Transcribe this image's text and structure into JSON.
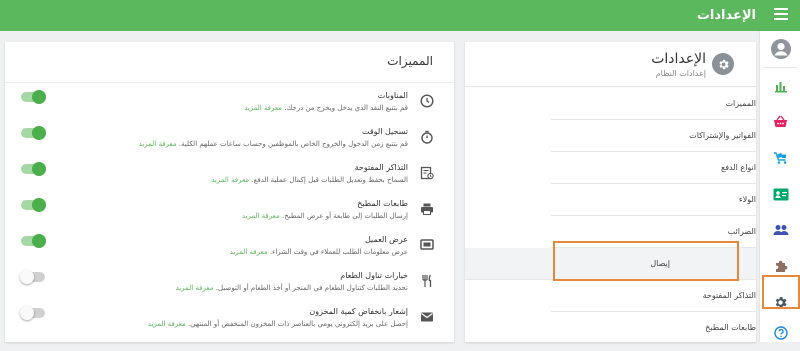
{
  "topbar": {
    "title": "الإعدادات"
  },
  "settings": {
    "title": "الإعدادات",
    "subtitle": "إعدادات النظام",
    "items": [
      {
        "label": "المميزات"
      },
      {
        "label": "الفواتير والإشتراكات"
      },
      {
        "label": "انواع الدفع"
      },
      {
        "label": "الولاء"
      },
      {
        "label": "الضرائب"
      },
      {
        "label": "إيصال"
      },
      {
        "label": "التذاكر المفتوحة"
      },
      {
        "label": "طابعات المطبخ"
      }
    ],
    "selected": "إيصال"
  },
  "features": {
    "title": "المميزات",
    "learn_more": "معرفة المزيد",
    "rows": [
      {
        "icon": "clock-icon",
        "title": "المناوبات",
        "desc": "قم بتتبع النقد الذي يدخل ويخرج من درجك.",
        "enabled": true
      },
      {
        "icon": "stopwatch-icon",
        "title": "تسجيل الوقت",
        "desc": "قم بتتبع زمن الدخول والخروج الخاص بالموظفين وحساب ساعات عملهم الكلية.",
        "enabled": true
      },
      {
        "icon": "ticket-icon",
        "title": "التذاكر المفتوحة",
        "desc": "السماح بحفظ وتعديل الطلبات قبل إكمال عملية الدفع.",
        "enabled": true
      },
      {
        "icon": "printer-icon",
        "title": "طابعات المطبخ",
        "desc": "إرسال الطلبات إلى طابعة أو عرض المطبخ.",
        "enabled": true
      },
      {
        "icon": "display-icon",
        "title": "عرض العميل",
        "desc": "عرض معلومات الطلب للعملاء في وقت الشراء.",
        "enabled": true
      },
      {
        "icon": "utensils-icon",
        "title": "خيارات تناول الطعام",
        "desc": "تحديد الطلبات كتناول الطعام في المتجر أو أخذ الطعام أو التوصيل.",
        "enabled": false
      },
      {
        "icon": "mail-icon",
        "title": "إشعار بانخفاض كمية المخزون",
        "desc": "إحصل على بريد إلكتروني يومي بالعناصر ذات المخزون المنخفض أو المنتهي.",
        "enabled": false
      }
    ]
  },
  "rail": {
    "items": [
      {
        "icon": "user-avatar-icon"
      },
      {
        "icon": "bar-chart-icon"
      },
      {
        "icon": "basket-icon"
      },
      {
        "icon": "cart-icon"
      },
      {
        "icon": "id-card-icon"
      },
      {
        "icon": "users-icon"
      },
      {
        "icon": "puzzle-icon"
      },
      {
        "icon": "gear-icon"
      },
      {
        "icon": "help-icon"
      }
    ],
    "active": "gear-icon"
  },
  "colors": {
    "primary": "#5cb85c",
    "highlight": "#e8883a"
  }
}
